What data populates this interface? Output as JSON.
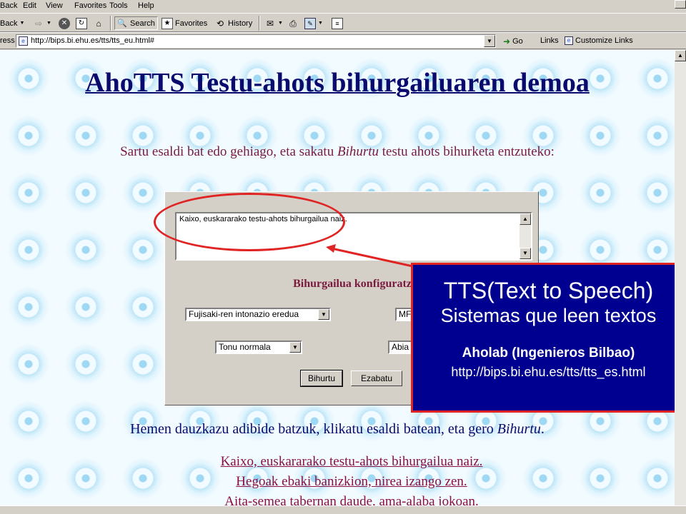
{
  "menubar": {
    "items": [
      "Back",
      "Edit",
      "View",
      "Favorites",
      "Tools",
      "Help"
    ]
  },
  "toolbar": {
    "back_label": "Back",
    "search_label": "Search",
    "favorites_label": "Favorites",
    "history_label": "History"
  },
  "addressbar": {
    "label": "ress",
    "url": "http://bips.bi.ehu.es/tts/tts_eu.html#",
    "go_label": "Go",
    "links_label": "Links",
    "customize_label": "Customize Links"
  },
  "page": {
    "title": "AhoTTS Testu-ahots bihurgailuaren demoa",
    "instruction_pre": "Sartu esaldi bat edo gehiago, eta sakatu ",
    "instruction_em": "Bihurtu",
    "instruction_post": " testu ahots bihurketa entzuteko:",
    "textarea_value": "Kaixo, euskararako testu-ahots bihurgailua naiz.",
    "config_label": "Bihurgailua konfiguratz",
    "select_intonation": "Fujisaki-ren intonazio eredua",
    "select_voice": "MF",
    "select_tone": "Tonu normala",
    "select_speed": "Abia",
    "convert_button": "Bihurtu",
    "clear_button": "Ezabatu",
    "examples_intro_pre": "Hemen dauzkazu adibide batzuk, klikatu esaldi batean, eta gero ",
    "examples_intro_em": "Bihurtu",
    "examples_intro_post": ".",
    "examples": [
      "Kaixo, euskararako testu-ahots bihurgailua naiz.",
      "Hegoak ebaki banizkion, nirea izango zen.",
      "Aita-semea tabernan daude, ama-alaba jokoan."
    ]
  },
  "callout": {
    "line1": "TTS(Text to Speech)",
    "line2": "Sistemas que leen textos",
    "line3": "Aholab (Ingenieros Bilbao)",
    "line4": "http://bips.bi.ehu.es/tts/tts_es.html"
  },
  "colors": {
    "title": "#0a0a6e",
    "instruction": "#7a1a3e",
    "callout_bg": "#000090",
    "highlight": "#e02424"
  }
}
